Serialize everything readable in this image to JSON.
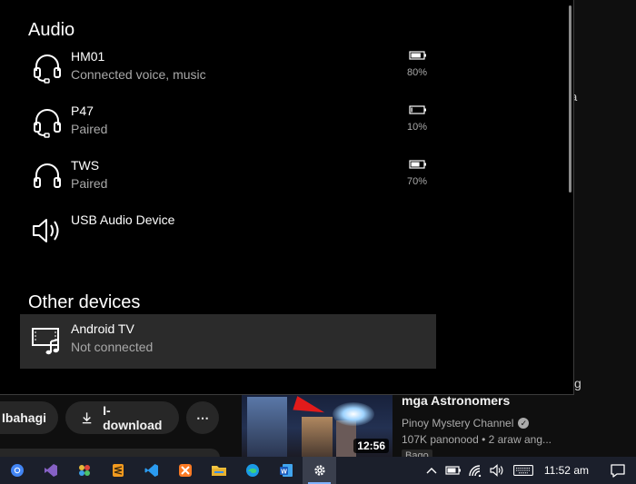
{
  "background": {
    "right_fragments": [
      "a",
      "g"
    ],
    "actions": {
      "share_label": "Ibahagi",
      "download_label": "I-download",
      "more_label": "⋯"
    },
    "video": {
      "title": "mga Astronomers",
      "channel": "Pinoy Mystery Channel",
      "meta": "107K panonood • 2 araw ang...",
      "badge": "Bago",
      "duration": "12:56"
    }
  },
  "flyout": {
    "audio_title": "Audio",
    "other_title": "Other devices",
    "audio_devices": [
      {
        "name": "HM01",
        "status": "Connected voice, music",
        "battery": "80%",
        "battery_level": 0.8,
        "icon": "headset-icon"
      },
      {
        "name": "P47",
        "status": "Paired",
        "battery": "10%",
        "battery_level": 0.1,
        "icon": "headset-icon"
      },
      {
        "name": "TWS",
        "status": "Paired",
        "battery": "70%",
        "battery_level": 0.7,
        "icon": "headphones-icon"
      },
      {
        "name": "USB Audio Device",
        "status": "",
        "icon": "speaker-icon"
      }
    ],
    "other_devices": [
      {
        "name": "Android TV",
        "status": "Not connected",
        "icon": "tv-music-icon"
      }
    ]
  },
  "taskbar": {
    "apps": [
      "chrome-icon",
      "visual-studio-icon",
      "color-app-icon",
      "sublime-icon",
      "vscode-icon",
      "xampp-icon",
      "file-explorer-icon",
      "edge-icon",
      "word-icon",
      "settings-icon"
    ],
    "active_app": "settings-icon",
    "time": "11:52 am"
  },
  "colors": {
    "flyout_bg": "#000000",
    "selected_bg": "#2b2b2b",
    "taskbar_bg": "#1b1f2b",
    "accent": "#7fb3ff"
  }
}
